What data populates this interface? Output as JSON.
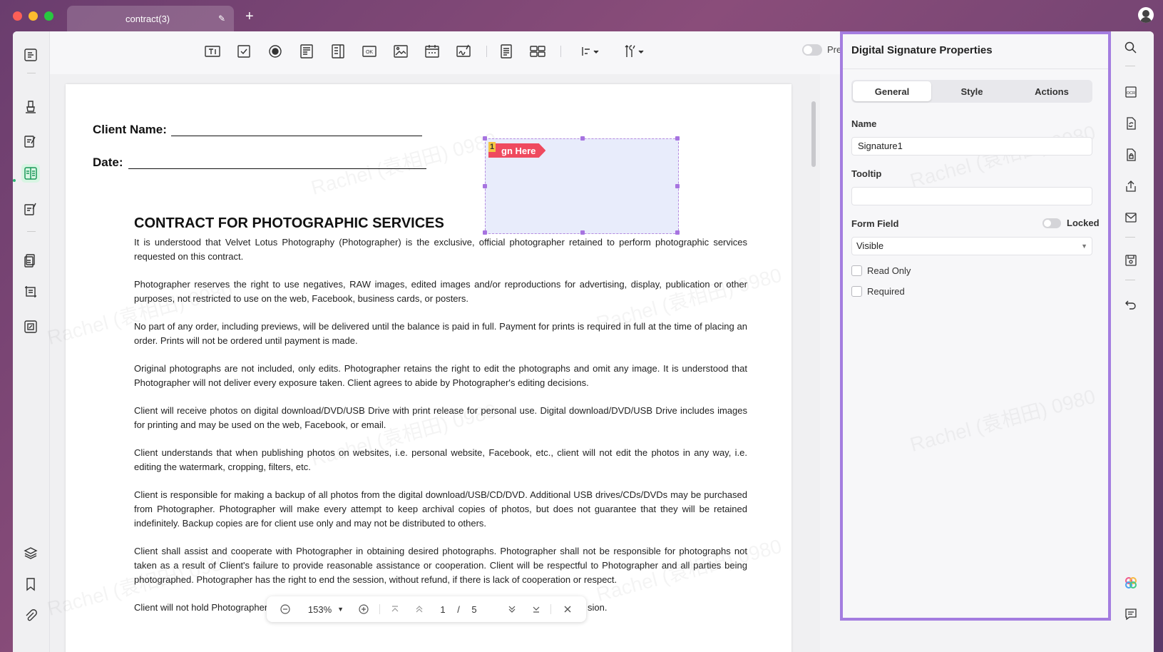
{
  "window": {
    "tab_title": "contract(3)",
    "new_tab": "+"
  },
  "toolbar": {
    "tools": [
      "text-field-icon",
      "checkbox-icon",
      "radio-button-icon",
      "list-box-icon",
      "dropdown-icon",
      "button-icon",
      "image-field-icon",
      "date-field-icon",
      "signature-field-icon",
      "details-icon",
      "grid-icon",
      "align-icon",
      "tools-icon"
    ],
    "preview_label": "Preview"
  },
  "document": {
    "client_name_label": "Client Name:",
    "date_label": "Date:",
    "title": "CONTRACT FOR PHOTOGRAPHIC SERVICES",
    "paragraphs": [
      "It is understood that Velvet Lotus Photography (Photographer) is the exclusive, official photographer retained to perform photographic services requested on this contract.",
      "Photographer reserves the right to use negatives, RAW images, edited images and/or reproductions for advertising, display, publication or other purposes, not restricted to use on the web, Facebook, business cards, or posters.",
      "No part of any order, including previews, will be delivered until the balance is paid in full. Payment for prints is required in full at the time of placing an order. Prints will not be ordered until payment is made.",
      "Original photographs are not included, only edits. Photographer retains the right to edit the photographs and omit any image. It is understood that Photographer will not deliver every exposure taken. Client agrees to abide by Photographer's editing decisions.",
      "Client will receive photos on digital download/DVD/USB Drive with print release for personal use. Digital download/DVD/USB Drive includes images for printing and may be used on the web, Facebook, or email.",
      "Client understands that when publishing photos on websites, i.e. personal website, Facebook, etc., client will not edit the photos in any way, i.e. editing the watermark, cropping, filters, etc.",
      "Client is responsible for making a backup of all photos from the digital download/USB/CD/DVD. Additional USB drives/CDs/DVDs may be purchased from Photographer. Photographer will make every attempt to keep archival copies of photos, but does not guarantee that they will be retained indefinitely. Backup copies are for client use only and may not be distributed to others.",
      "Client shall assist and cooperate with Photographer in obtaining desired photographs. Photographer shall not be responsible for photographs not taken as a result of Client's failure to provide reasonable assistance or cooperation. Client will be respectful to Photographer and all parties being photographed. Photographer has the right to end the session, without refund, if there is lack of cooperation or respect.",
      "Client will not hold Photographer",
      "sion."
    ],
    "signature": {
      "number": "1",
      "tag": "gn Here"
    },
    "watermark": "Rachel (袁相田) 0980"
  },
  "nav": {
    "zoom": "153%",
    "current_page": "1",
    "separator": "/",
    "total_pages": "5"
  },
  "properties": {
    "title": "Digital Signature Properties",
    "tabs": [
      "General",
      "Style",
      "Actions"
    ],
    "active_tab": "General",
    "name_label": "Name",
    "name_value": "Signature1",
    "tooltip_label": "Tooltip",
    "tooltip_value": "",
    "form_field_label": "Form Field",
    "locked_label": "Locked",
    "visibility_value": "Visible",
    "read_only_label": "Read Only",
    "required_label": "Required"
  },
  "colors": {
    "accent_purple": "#a47de0",
    "sign_tag": "#ef4a5e",
    "sidebar_active": "#29b673"
  }
}
